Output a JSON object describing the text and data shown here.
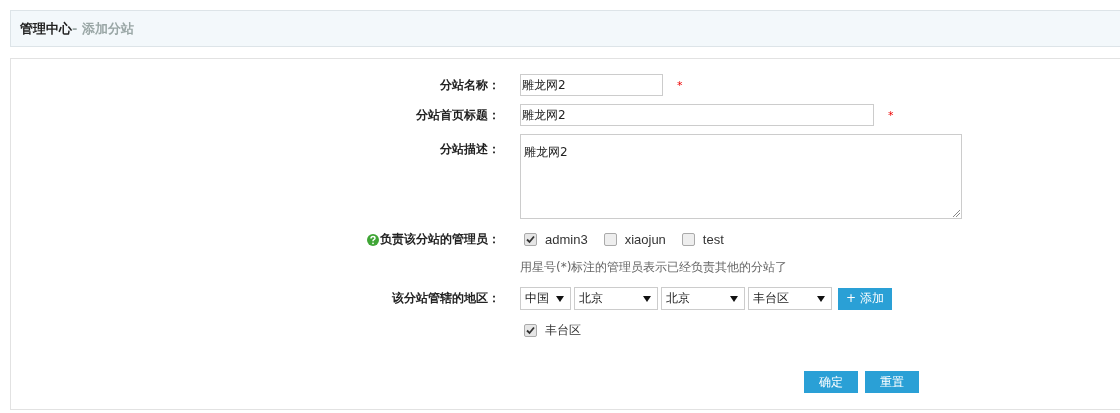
{
  "header": {
    "title": "管理中心",
    "subtitle": "- 添加分站"
  },
  "form": {
    "name": {
      "label": "分站名称：",
      "value": "雕龙网2",
      "required": "*"
    },
    "title": {
      "label": "分站首页标题：",
      "value": "雕龙网2",
      "required": "*"
    },
    "description": {
      "label": "分站描述：",
      "value": "雕龙网2"
    },
    "admins": {
      "label": "负责该分站的管理员：",
      "help": true,
      "options": [
        {
          "label": "admin3",
          "checked": true
        },
        {
          "label": "xiaojun",
          "checked": false
        },
        {
          "label": "test",
          "checked": false
        }
      ],
      "hint": "用星号(*)标注的管理员表示已经负责其他的分站了"
    },
    "region": {
      "label": "该分站管辖的地区：",
      "selects": [
        {
          "value": "中国",
          "kind": "narrow"
        },
        {
          "value": "北京",
          "kind": "wide"
        },
        {
          "value": "北京",
          "kind": "wide"
        },
        {
          "value": "丰台区",
          "kind": "wide"
        }
      ],
      "add_button": "+ 添加",
      "chosen": [
        {
          "label": "丰台区",
          "checked": true
        }
      ]
    }
  },
  "buttons": [
    "确定",
    "重置"
  ]
}
